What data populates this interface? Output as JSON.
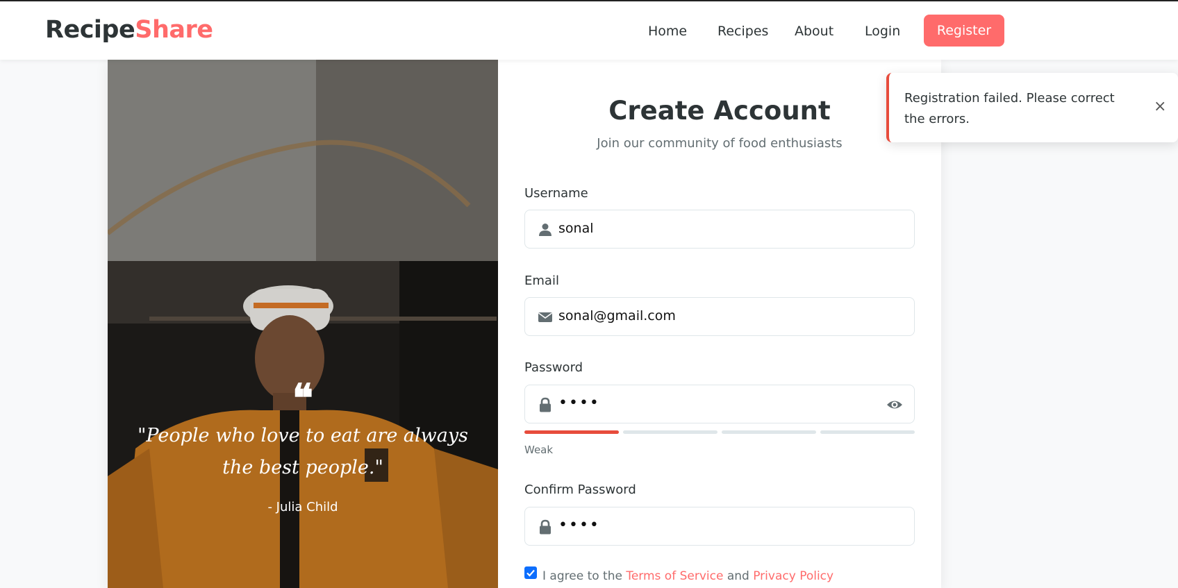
{
  "brand": {
    "part1": "Recipe",
    "part2": "Share"
  },
  "nav": {
    "home": "Home",
    "recipes": "Recipes",
    "about": "About",
    "login": "Login",
    "register": "Register"
  },
  "quote": {
    "mark": "❝",
    "text": "\"People who love to eat are always the best people.\"",
    "author": "- Julia Child"
  },
  "form": {
    "title": "Create Account",
    "subtitle": "Join our community of food enthusiasts",
    "username": {
      "label": "Username",
      "value": "sonal",
      "icon": "user-icon"
    },
    "email": {
      "label": "Email",
      "value": "sonal@gmail.com",
      "icon": "envelope-icon"
    },
    "password": {
      "label": "Password",
      "value": "••••",
      "icon": "lock-icon",
      "strength_label": "Weak",
      "strength_level": 0.25
    },
    "confirm_password": {
      "label": "Confirm Password",
      "value": "••••",
      "icon": "lock-icon"
    },
    "agree": {
      "prefix": "I agree to the",
      "terms": "Terms of Service",
      "and": "and",
      "privacy": "Privacy Policy",
      "checked": true
    }
  },
  "toast": {
    "message": "Registration failed. Please correct the errors.",
    "close": "×"
  },
  "colors": {
    "accent": "#ff6b6b",
    "error": "#e74c3c",
    "text": "#2d3436",
    "muted": "#636e72"
  }
}
